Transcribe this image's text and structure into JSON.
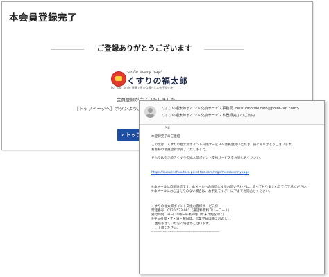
{
  "page": {
    "title": "本会員登録完了",
    "heading": "ご登録ありがとうございます",
    "logo": {
      "tagline": "smile every day!",
      "name": "くすりの福太郎",
      "sub": "For Your Smile 健康で豊かな暮らしのお手伝いを"
    },
    "message_line1": "会員登録が完了いたしました。",
    "message_line2": "［トップページへ］ボタンより、ポイン",
    "button_label": "トップペ"
  },
  "mail": {
    "from": "くすりの福太郎ポイント交換サービス事務局 <kusurinofukutaro@point-fan.com>",
    "subject": "くすりの福太郎ポイント交換サービス本登録完了のご案内",
    "recipient": "さま",
    "lines": [
      "本登録完了のご連絡",
      "この度は、くすりの福太郎ポイント交換サービスへ会員登録いただき、誠にありがとうございます。",
      "お客様の会員登録が完了いたしました。",
      "それでは引き続きくすりの福太郎ポイント交換サービスをお楽しみください。",
      "https://kusurinofukutaro.point-fan.com/mgs/member/mypage",
      "※本メールは自動送信です。本メールへの返信によるお問い合わせは、承っておりませんのでご了承ください。",
      "※本メールにお心当たりのない場合は、お手数ですが、以下までお問合せください。",
      "-----------------------------------------------------------",
      "くすりの福太郎ポイント交換お客様サービス係",
      "電話番号：0120-523-981（通話料無料フリーコール）",
      "受付時間：平日 10時〜午後 6時（年末年始を除く）",
      "※平日夜間・土・日・祝日は、営業翌日以降にお返しご",
      "　連絡させていただく場合がございます。",
      "　ご了承ください。",
      "-----------------------------------------------------------"
    ]
  }
}
